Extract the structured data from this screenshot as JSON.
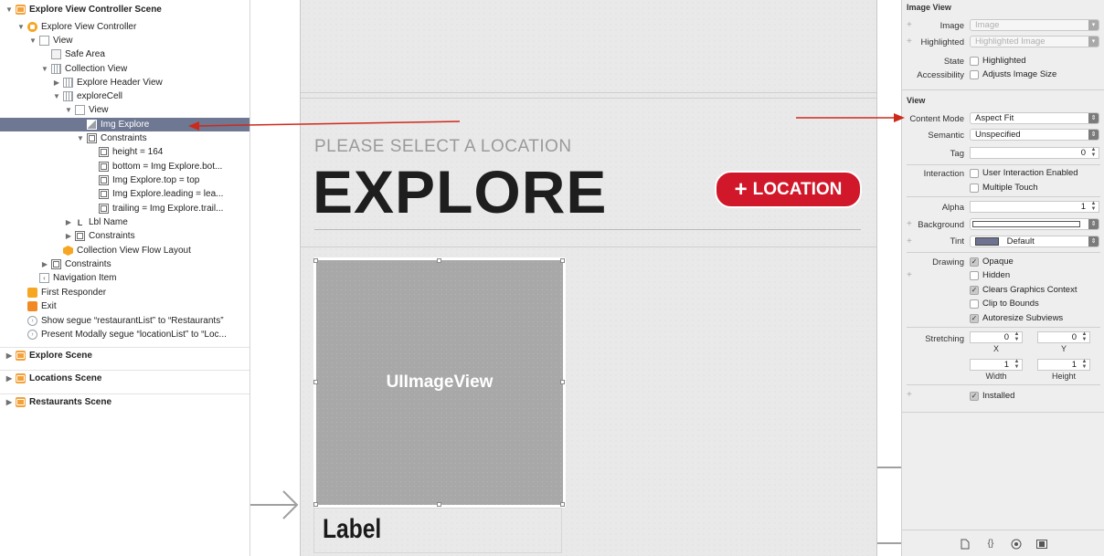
{
  "outline": {
    "rows": [
      {
        "label": "Explore View Controller Scene",
        "depth": 0,
        "tri": "▼",
        "icon": "scene-icon"
      },
      {
        "label": "Explore View Controller",
        "depth": 1,
        "tri": "▼",
        "icon": "view-controller-icon"
      },
      {
        "label": "View",
        "depth": 2,
        "tri": "▼",
        "icon": "view-icon"
      },
      {
        "label": "Safe Area",
        "depth": 3,
        "tri": "",
        "icon": "safe-area-icon"
      },
      {
        "label": "Collection View",
        "depth": 3,
        "tri": "▼",
        "icon": "collection-view-icon"
      },
      {
        "label": "Explore Header View",
        "depth": 4,
        "tri": "▶",
        "icon": "collection-reusable-view-icon"
      },
      {
        "label": "exploreCell",
        "depth": 4,
        "tri": "▼",
        "icon": "collection-cell-icon"
      },
      {
        "label": "View",
        "depth": 5,
        "tri": "▼",
        "icon": "view-icon"
      },
      {
        "label": "Img Explore",
        "depth": 6,
        "tri": "",
        "icon": "image-view-icon"
      },
      {
        "label": "Constraints",
        "depth": 6,
        "tri": "▼",
        "icon": "constraints-icon"
      },
      {
        "label": "height = 164",
        "depth": 7,
        "tri": "",
        "icon": "constraint-icon"
      },
      {
        "label": "bottom = Img Explore.bot...",
        "depth": 7,
        "tri": "",
        "icon": "constraint-icon"
      },
      {
        "label": "Img Explore.top = top",
        "depth": 7,
        "tri": "",
        "icon": "constraint-icon"
      },
      {
        "label": "Img Explore.leading = lea...",
        "depth": 7,
        "tri": "",
        "icon": "constraint-icon"
      },
      {
        "label": "trailing = Img Explore.trail...",
        "depth": 7,
        "tri": "",
        "icon": "constraint-icon"
      },
      {
        "label": "Lbl Name",
        "depth": 5,
        "tri": "▶",
        "icon": "label-icon"
      },
      {
        "label": "Constraints",
        "depth": 5,
        "tri": "▶",
        "icon": "constraints-icon"
      },
      {
        "label": "Collection View Flow Layout",
        "depth": 4,
        "tri": "",
        "icon": "flow-layout-icon"
      },
      {
        "label": "Constraints",
        "depth": 3,
        "tri": "▶",
        "icon": "constraints-icon"
      },
      {
        "label": "Navigation Item",
        "depth": 2,
        "tri": "",
        "icon": "navigation-item-icon"
      },
      {
        "label": "First Responder",
        "depth": 1,
        "tri": "",
        "icon": "first-responder-icon"
      },
      {
        "label": "Exit",
        "depth": 1,
        "tri": "",
        "icon": "exit-icon"
      },
      {
        "label": "Show segue “restaurantList” to “Restaurants”",
        "depth": 1,
        "tri": "",
        "icon": "segue-icon"
      },
      {
        "label": "Present Modally segue “locationList” to “Loc...",
        "depth": 1,
        "tri": "",
        "icon": "segue-icon"
      }
    ],
    "scenes": [
      {
        "label": "Explore Scene"
      },
      {
        "label": "Locations Scene"
      },
      {
        "label": "Restaurants Scene"
      }
    ],
    "selected_index": 8
  },
  "canvas": {
    "subtitle": "PLEASE SELECT A LOCATION",
    "title": "EXPLORE",
    "location_button": {
      "plus": "+",
      "label": "LOCATION"
    },
    "image_view_label": "UIImageView",
    "cell_label": "Label"
  },
  "inspector": {
    "image_view": {
      "title": "Image View",
      "image_label": "Image",
      "image_placeholder": "Image",
      "highlighted_label": "Highlighted",
      "highlighted_placeholder": "Highlighted Image",
      "state_label": "State",
      "state_checkbox": "Highlighted",
      "accessibility_label": "Accessibility",
      "accessibility_checkbox": "Adjusts Image Size"
    },
    "view": {
      "title": "View",
      "content_mode_label": "Content Mode",
      "content_mode_value": "Aspect Fit",
      "semantic_label": "Semantic",
      "semantic_value": "Unspecified",
      "tag_label": "Tag",
      "tag_value": "0",
      "interaction_label": "Interaction",
      "user_interaction": "User Interaction Enabled",
      "multiple_touch": "Multiple Touch",
      "alpha_label": "Alpha",
      "alpha_value": "1",
      "background_label": "Background",
      "tint_label": "Tint",
      "tint_value": "Default",
      "tint_color": "#6d7391",
      "drawing_label": "Drawing",
      "opaque": "Opaque",
      "hidden": "Hidden",
      "clears_graphics": "Clears Graphics Context",
      "clip_to_bounds": "Clip to Bounds",
      "autoresize": "Autoresize Subviews",
      "stretching_label": "Stretching",
      "stretch_x": "0",
      "stretch_y": "0",
      "x_caption": "X",
      "y_caption": "Y",
      "stretch_width": "1",
      "stretch_height": "1",
      "width_caption": "Width",
      "height_caption": "Height",
      "installed": "Installed"
    }
  },
  "colors": {
    "selection": "#6f7892",
    "accent_red": "#d0182a",
    "annotation_arrow": "#cc2a1a"
  }
}
